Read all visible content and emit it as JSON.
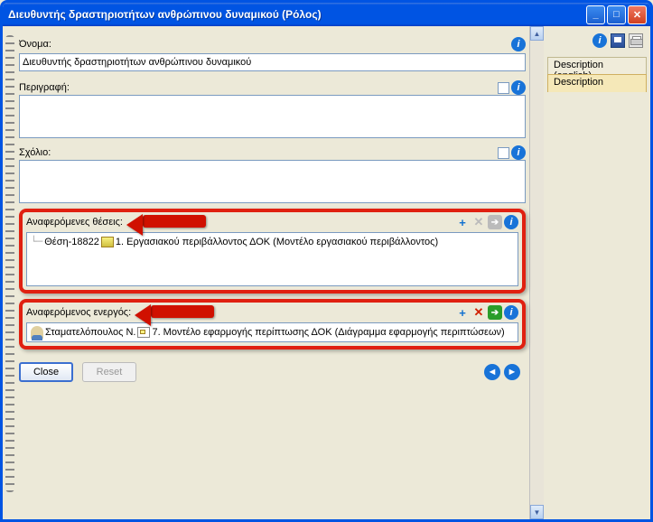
{
  "window": {
    "title": "Διευθυντής δραστηριοτήτων ανθρώπινου δυναμικού (Ρόλος)"
  },
  "toolbar": {
    "info": "i"
  },
  "sideTabs": {
    "description_en": "Description (english)",
    "description": "Description"
  },
  "fields": {
    "name_label": "Όνομα:",
    "name_value": "Διευθυντής δραστηριοτήτων ανθρώπινου δυναμικού",
    "description_label": "Περιγραφή:",
    "comment_label": "Σχόλιο:"
  },
  "sections": {
    "positions": {
      "title": "Αναφερόμενες θέσεις:",
      "items": [
        {
          "prefix": "Θέση-18822",
          "text": "1. Εργασιακού περιβάλλοντος ΔΟΚ (Μοντέλο εργασιακού περιβάλλοντος)"
        }
      ]
    },
    "actor": {
      "title": "Αναφερόμενος ενεργός:",
      "items": [
        {
          "prefix": "Σταματελόπουλος Ν.",
          "text": "7. Μοντέλο εφαρμογής περίπτωσης ΔΟΚ (Διάγραμμα εφαρμογής περιπτώσεων)"
        }
      ]
    }
  },
  "buttons": {
    "close": "Close",
    "reset": "Reset"
  }
}
